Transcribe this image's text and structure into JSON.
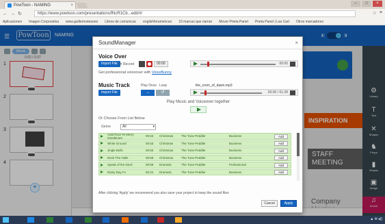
{
  "browser": {
    "tab_title": "PowToon - NAMING",
    "url": "https://www.powtoon.com/presentations/fNcR1Cb...edit/#/",
    "bookmarks": [
      "Aplicaciones",
      "Imagen Corporativa",
      "www.guillermotesone",
      "Libros de comunicac",
      "englishforamerican",
      "10 marcas que narran",
      "Mover Prieta Panel",
      "Prieta Panel | Las Cart",
      "Otros marcadores"
    ]
  },
  "app": {
    "logo_text": "PowToon",
    "title": "NAMING",
    "slide_label": "Movie",
    "timecode": "0:02 / 0:37",
    "slide_numbers": [
      "1",
      "2",
      "3",
      "4"
    ],
    "right_tools": [
      "Library",
      "Text",
      "Shapes",
      "Props",
      "Graphs",
      "Image",
      "Sound"
    ],
    "canvas_texts": {
      "inspiration": "INSPIRATION",
      "staff_line1": "STAFF",
      "staff_line2": "MEETING",
      "company": "Company",
      "meeting": "Meeting"
    }
  },
  "modal": {
    "title": "SoundManager",
    "close": "×",
    "voiceover": {
      "heading": "Voice Over",
      "import_label": "Import File",
      "or_record": "Or Record",
      "rec_time": "00:00",
      "player_time": "00:00",
      "promo_text": "Get professional voiceover with",
      "promo_link": "VoiceBunny"
    },
    "music": {
      "heading": "Music Track",
      "import_label": "Import File",
      "play_once": "Play Once",
      "loop": "Loop",
      "play_once_icon": "→",
      "loop_icon": "↺",
      "filename": "the_crem_of_dawn.mp3",
      "player_time": "00:00 / 01:28"
    },
    "together_label": "Play Music and Voiceover together",
    "choose_label": "Or Choose From List Below",
    "genre_label": "Genre",
    "genre_value": "All",
    "tracks": [
      {
        "title": "Auld Root Ye Merry Gentlemen",
        "time": "00:53",
        "genre": "Christmas",
        "artist": "The Tune Peddler",
        "style": "Business",
        "add": "Add"
      },
      {
        "title": "White Ground",
        "time": "00:53",
        "genre": "Christmas",
        "artist": "The Tune Peddler",
        "style": "Business",
        "add": "Add"
      },
      {
        "title": "Jingle Bells",
        "time": "00:55",
        "genre": "Christmas",
        "artist": "The Tune Peddler",
        "style": "Business",
        "add": "Add"
      },
      {
        "title": "Deck The Halls",
        "time": "00:59",
        "genre": "Christmas",
        "artist": "The Tune Peddler",
        "style": "Business",
        "add": "Add"
      },
      {
        "title": "Speak of the Devil",
        "time": "00:59",
        "genre": "Dramatic",
        "artist": "The Tune Peddler",
        "style": "Professional",
        "add": "Add"
      },
      {
        "title": "Rainy Day Fx",
        "time": "00:24",
        "genre": "Dramatic",
        "artist": "The Tune Peddler",
        "style": "Business",
        "add": "Add"
      }
    ],
    "footnote": "After clicking 'Apply' we recommend you also save your project to keep the sound files",
    "cancel": "Cancel",
    "apply": "Apply"
  },
  "colors": {
    "brand_blue": "#1565c0",
    "track_green": "#d4efc2",
    "record_red": "#c62828"
  }
}
